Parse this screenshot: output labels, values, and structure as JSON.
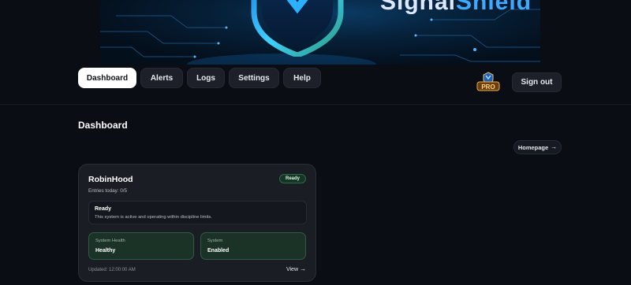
{
  "banner": {
    "brand_part1": "Signal",
    "brand_part2": "Shield"
  },
  "nav": {
    "items": [
      {
        "label": "Dashboard",
        "active": true
      },
      {
        "label": "Alerts"
      },
      {
        "label": "Logs"
      },
      {
        "label": "Settings"
      },
      {
        "label": "Help"
      }
    ]
  },
  "header": {
    "pro_badge_icon": "signalshield-pro-badge",
    "pro_label": "PRO",
    "signout_label": "Sign out"
  },
  "page": {
    "title": "Dashboard",
    "homepage_label": "Homepage",
    "arrow_icon": "arrow-right-icon"
  },
  "card": {
    "title": "RobinHood",
    "status": "Ready",
    "entries": "Entries today: 0/5",
    "notice": {
      "title": "Ready",
      "text": "This system is active and operating within discipline limits."
    },
    "stats": [
      {
        "label": "System Health",
        "value": "Healthy"
      },
      {
        "label": "System",
        "value": "Enabled"
      }
    ],
    "updated": "Updated: 12:00:00 AM",
    "view_label": "View"
  },
  "colors": {
    "background": "#0a0d14",
    "accent_blue": "#3fa8ff",
    "status_green": "#2c6a48",
    "button_bg": "#1d2029"
  }
}
